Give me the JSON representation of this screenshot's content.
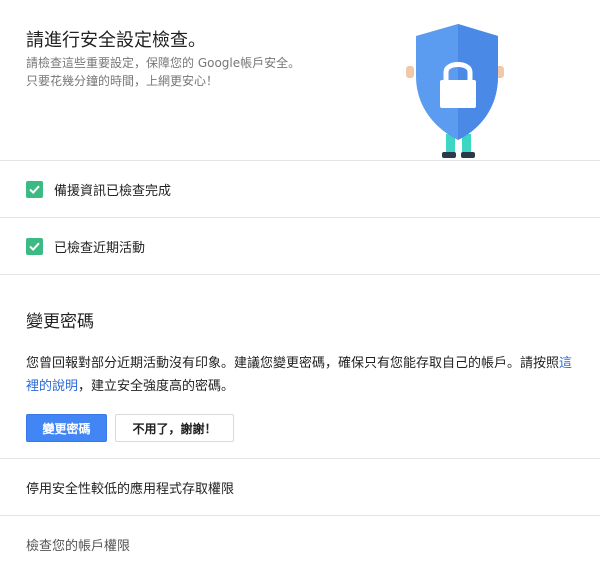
{
  "header": {
    "title": "請進行安全設定檢查。",
    "subtitle_line1": "請檢查這些重要設定，保障您的 Google帳戶安全。",
    "subtitle_line2": "只要花幾分鐘的時間，上網更安心！"
  },
  "checks": [
    {
      "label": "備援資訊已檢查完成",
      "status": "done"
    },
    {
      "label": "已檢查近期活動",
      "status": "done"
    }
  ],
  "password_section": {
    "title": "變更密碼",
    "text_part1": "您曾回報對部分近期活動沒有印象。建議您變更密碼，確保只有您能存取自己的帳戶。請按照",
    "link_text": "這裡的說明",
    "text_part2": "，建立安全強度高的密碼。",
    "primary_button": "變更密碼",
    "secondary_button": "不用了，謝謝！"
  },
  "less_secure_apps": {
    "label": "停用安全性較低的應用程式存取權限"
  },
  "account_permissions": {
    "label": "檢查您的帳戶權限"
  },
  "colors": {
    "accent_blue": "#4285f4",
    "check_green": "#3cba84",
    "link_blue": "#2a6ad8",
    "shield_blue": "#5b9bf0"
  },
  "icons": {
    "shield": "shield-lock-icon",
    "check": "check-icon"
  }
}
